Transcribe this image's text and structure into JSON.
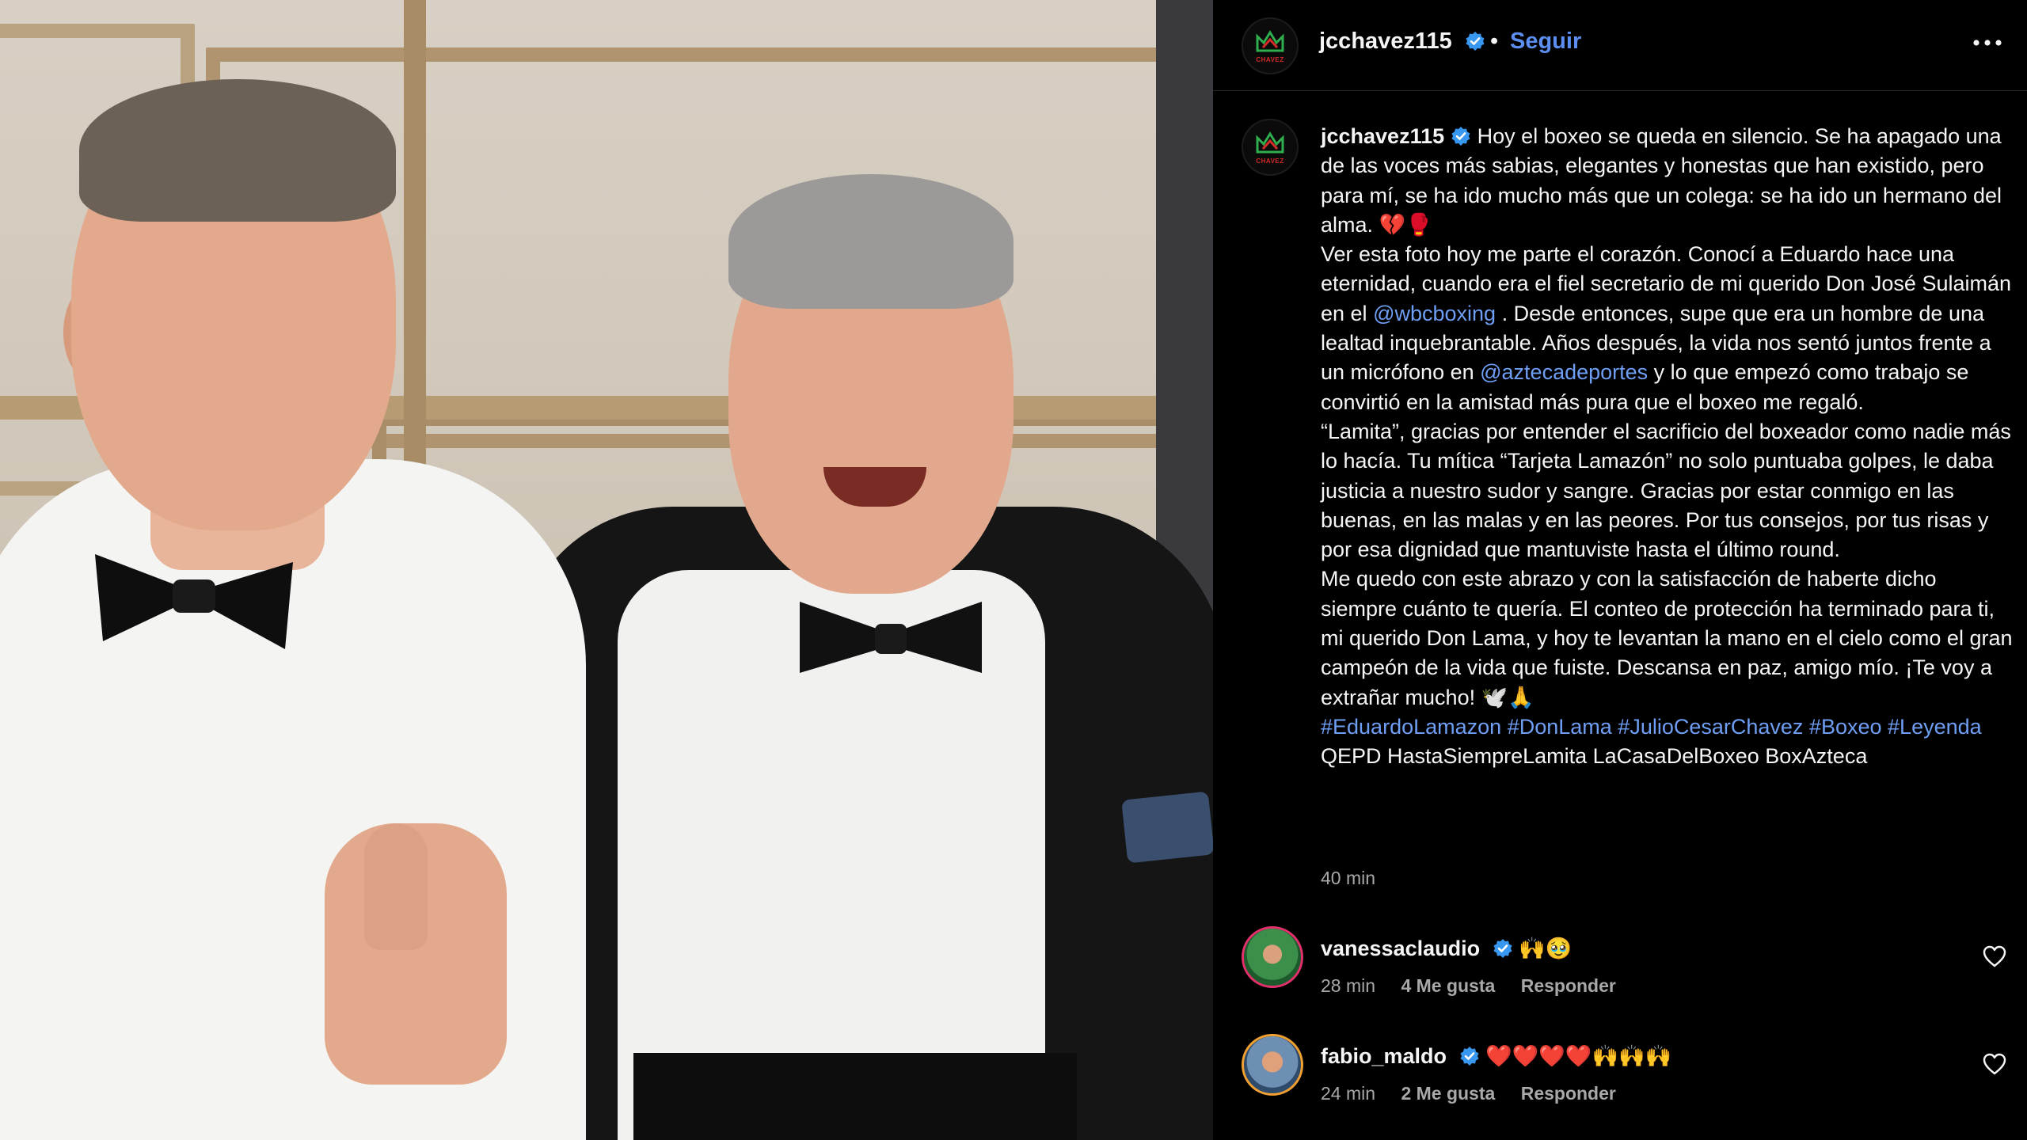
{
  "post": {
    "username": "jcchavez115",
    "follow_label": "Seguir",
    "separator": "•",
    "avatar_text": "CHAVEZ",
    "caption_time": "40 min",
    "caption": {
      "p1": "Hoy el boxeo se queda en silencio. Se ha apagado una de las voces más sabias, elegantes y honestas que han existido, pero para mí, se ha ido mucho más que un colega: se ha ido un hermano del alma. 💔🥊",
      "p2a": "Ver esta foto hoy me parte el corazón. Conocí a Eduardo hace una eternidad, cuando era el fiel secretario de mi querido Don José Sulaimán en el ",
      "mention1": "@wbcboxing",
      "p2b": " . Desde entonces, supe que era un hombre de una lealtad inquebrantable. Años después, la vida nos sentó juntos frente a un micrófono en ",
      "mention2": "@aztecadeportes",
      "p2c": " y lo que empezó como trabajo se convirtió en la amistad más pura que el boxeo me regaló.",
      "p3": "“Lamita”, gracias por entender el sacrificio del boxeador como nadie más lo hacía. Tu mítica “Tarjeta Lamazón” no solo puntuaba golpes, le daba justicia a nuestro sudor y sangre. Gracias por estar conmigo en las buenas, en las malas y en las peores. Por tus consejos, por tus risas y por esa dignidad que mantuviste hasta el último round.",
      "p4": "Me quedo con este abrazo y con la satisfacción de haberte dicho siempre cuánto te quería. El conteo de protección ha terminado para ti, mi querido Don Lama, y hoy te levantan la mano en el cielo como el gran campeón de la vida que fuiste. Descansa en paz, amigo mío. ¡Te voy a extrañar mucho! 🕊️🙏",
      "hashtags": [
        "#EduardoLamazon",
        "#DonLama",
        "#JulioCesarChavez",
        "#Boxeo",
        "#Leyenda"
      ],
      "tail": " QEPD HastaSiempreLamita LaCasaDelBoxeo BoxAzteca"
    }
  },
  "comments": [
    {
      "username": "vanessaclaudio",
      "text": "🙌🥹",
      "time": "28 min",
      "likes": "4 Me gusta",
      "reply": "Responder"
    },
    {
      "username": "fabio_maldo",
      "text": "❤️❤️❤️❤️🙌🙌🙌",
      "time": "24 min",
      "likes": "2 Me gusta",
      "reply": "Responder"
    }
  ],
  "colors": {
    "accent": "#5c8ff0",
    "link": "#6e9ff5",
    "muted": "#a8a8a8",
    "background": "#000000",
    "verified": "#3897f0"
  }
}
